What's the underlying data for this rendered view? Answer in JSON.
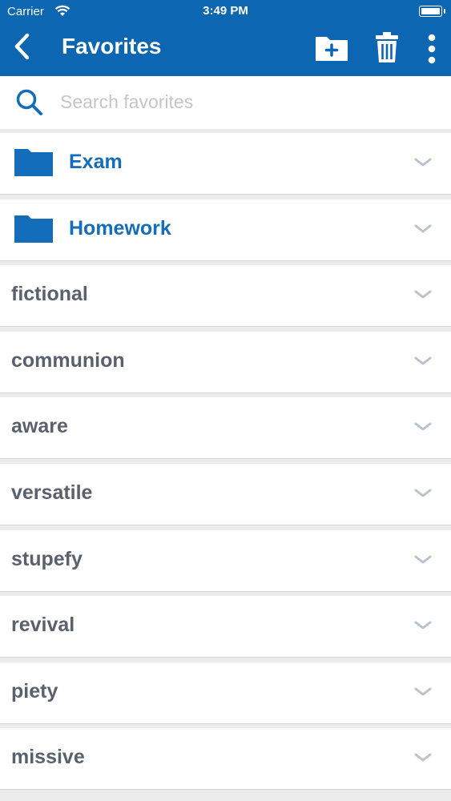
{
  "status_bar": {
    "carrier": "Carrier",
    "time": "3:49 PM"
  },
  "header": {
    "title": "Favorites",
    "icons": [
      "back-icon",
      "new-folder-icon",
      "trash-icon",
      "more-vertical-icon"
    ]
  },
  "search": {
    "placeholder": "Search favorites",
    "value": ""
  },
  "folders": [
    {
      "label": "Exam"
    },
    {
      "label": "Homework"
    }
  ],
  "words": [
    {
      "label": "fictional"
    },
    {
      "label": "communion"
    },
    {
      "label": "aware"
    },
    {
      "label": "versatile"
    },
    {
      "label": "stupefy"
    },
    {
      "label": "revival"
    },
    {
      "label": "piety"
    },
    {
      "label": "missive"
    }
  ],
  "colors": {
    "header_bg": "#0c66b1",
    "folder_text": "#136dba",
    "word_text": "#58616c",
    "chevron": "#b9c3cf",
    "background": "#ececec"
  }
}
